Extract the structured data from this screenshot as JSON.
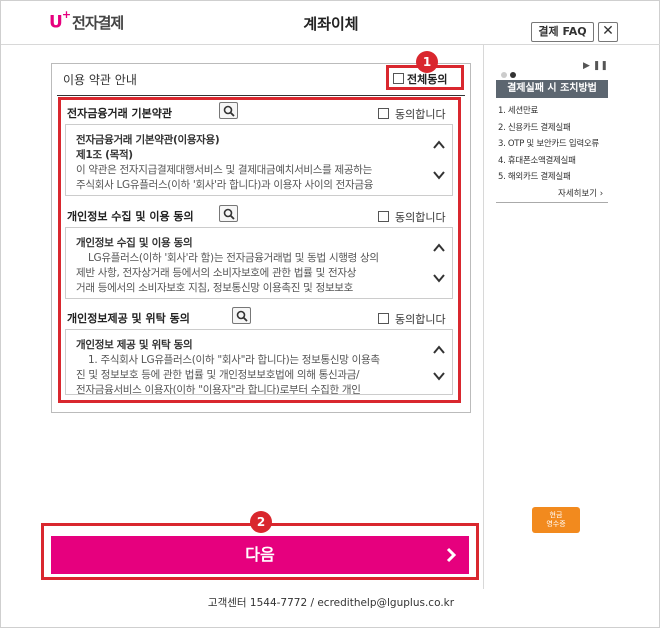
{
  "header": {
    "logo_mark": "U",
    "logo_plus": "+",
    "logo_text": "전자결제",
    "title": "계좌이체",
    "faq_label": "결제 FAQ",
    "close_label": "✕"
  },
  "terms_section": {
    "title": "이용 약관 안내",
    "all_agree_label": "전체동의",
    "badge_1": "1",
    "badge_2": "2"
  },
  "terms": [
    {
      "title": "전자금융거래 기본약관",
      "agree_label": "동의합니다",
      "lines": [
        "전자금융거래 기본약관(이용자용)",
        "제1조 (목적)",
        "이 약관은 전자지급결제대행서비스 및 결제대금예치서비스를 제공하는",
        "주식회사 LG유플러스(이하 '회사'라 합니다)과 이용자 사이의 전자금융"
      ]
    },
    {
      "title": "개인정보 수집 및 이용 동의",
      "agree_label": "동의합니다",
      "lines": [
        "개인정보 수집 및 이용 동의",
        "LG유플러스(이하 '회사'라 함)는 전자금융거래법 및 동법 시행령 상의",
        "제반 사항, 전자상거래 등에서의 소비자보호에 관한 법률 및 전자상",
        "거래 등에서의 소비자보호 지침, 정보통신망 이용촉진 및 정보보호"
      ]
    },
    {
      "title": "개인정보제공 및 위탁 동의",
      "agree_label": "동의합니다",
      "lines": [
        "개인정보 제공 및 위탁 동의",
        "1. 주식회사 LG유플러스(이하 \"회사\"라 합니다)는 정보통신망 이용촉",
        "진 및 정보보호 등에 관한 법률 및 개인정보보호법에 의해 통신과금/",
        "전자금융서비스 이용자(이하 \"이용자\"라 합니다)로부터 수집한 개인"
      ]
    }
  ],
  "next_button": {
    "label": "다음",
    "arrow": "›"
  },
  "footer": {
    "text": "고객센터 1544-7772 / ecredithelp@lguplus.co.kr"
  },
  "sidebar": {
    "heading": "결제실패 시 조치방법",
    "items": [
      "1. 세션만료",
      "2. 신용카드 결제실패",
      "3. OTP 및 보안카드 입력오류",
      "4. 휴대폰소액결제실패",
      "5. 해외카드 결제실패"
    ],
    "more_label": "자세히보기 ›",
    "play_label": "▶ ❚❚",
    "receipt_label_1": "현금",
    "receipt_label_2": "영수증"
  },
  "colors": {
    "brand": "#e6007e",
    "highlight": "#d9272e",
    "sidebar_head": "#5c6670"
  }
}
